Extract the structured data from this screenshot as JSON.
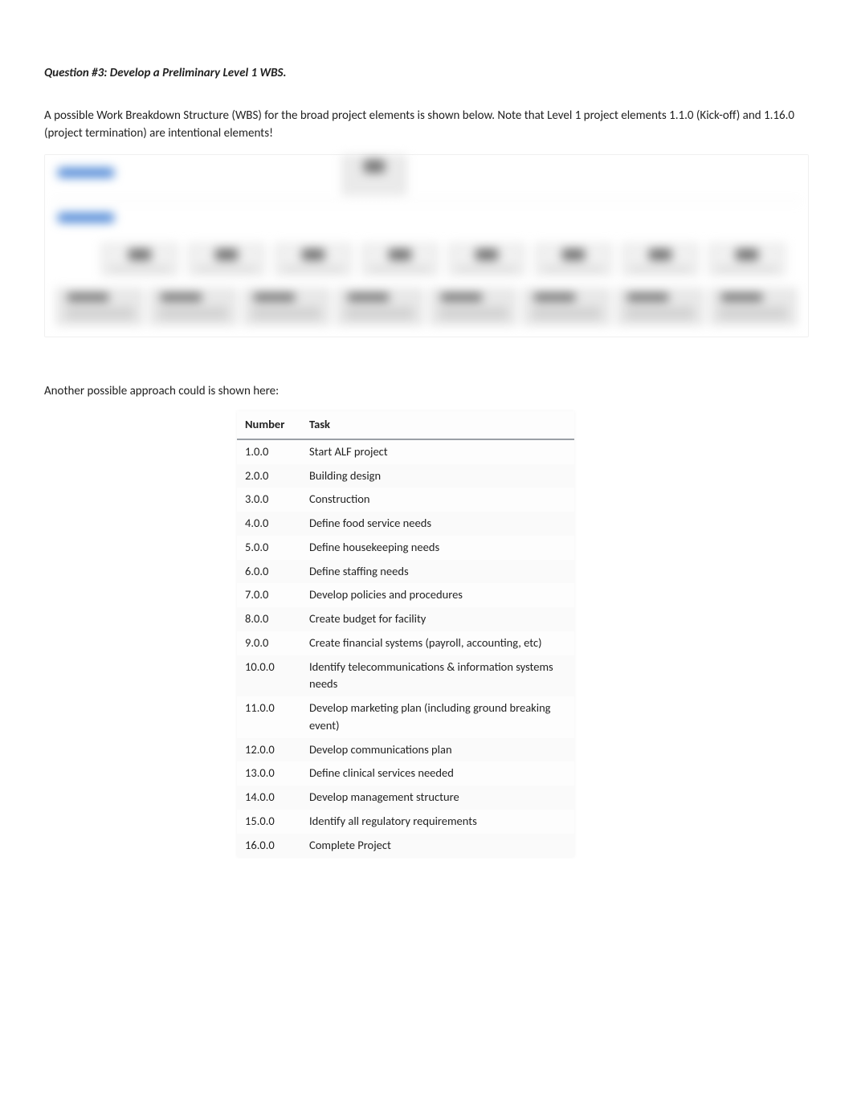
{
  "heading": "Question #3: Develop a Preliminary Level 1 WBS.",
  "paragraph": "A possible Work Breakdown Structure (WBS) for the broad project elements is shown below.   Note that Level 1 project elements 1.1.0 (Kick-off) and 1.16.0 (project termination) are intentional elements!",
  "sub_paragraph": "Another possible approach could is shown here:",
  "table": {
    "headers": {
      "number": "Number",
      "task": "Task"
    },
    "rows": [
      {
        "number": "1.0.0",
        "task": "Start ALF project"
      },
      {
        "number": "2.0.0",
        "task": "Building design"
      },
      {
        "number": "3.0.0",
        "task": "Construction"
      },
      {
        "number": "4.0.0",
        "task": "Define food service needs"
      },
      {
        "number": "5.0.0",
        "task": "Define housekeeping needs"
      },
      {
        "number": "6.0.0",
        "task": "Define staffing needs"
      },
      {
        "number": "7.0.0",
        "task": "Develop policies and procedures"
      },
      {
        "number": "8.0.0",
        "task": "Create budget for facility"
      },
      {
        "number": "9.0.0",
        "task": "Create financial systems (payroll, accounting, etc)"
      },
      {
        "number": "10.0.0",
        "task": "Identify telecommunications & information systems needs"
      },
      {
        "number": "11.0.0",
        "task": "Develop marketing plan (including ground breaking event)"
      },
      {
        "number": "12.0.0",
        "task": "Develop communications plan"
      },
      {
        "number": "13.0.0",
        "task": "Define clinical services needed"
      },
      {
        "number": "14.0.0",
        "task": "Develop management structure"
      },
      {
        "number": "15.0.0",
        "task": "Identify all regulatory requirements"
      },
      {
        "number": "16.0.0",
        "task": "Complete Project"
      }
    ]
  }
}
